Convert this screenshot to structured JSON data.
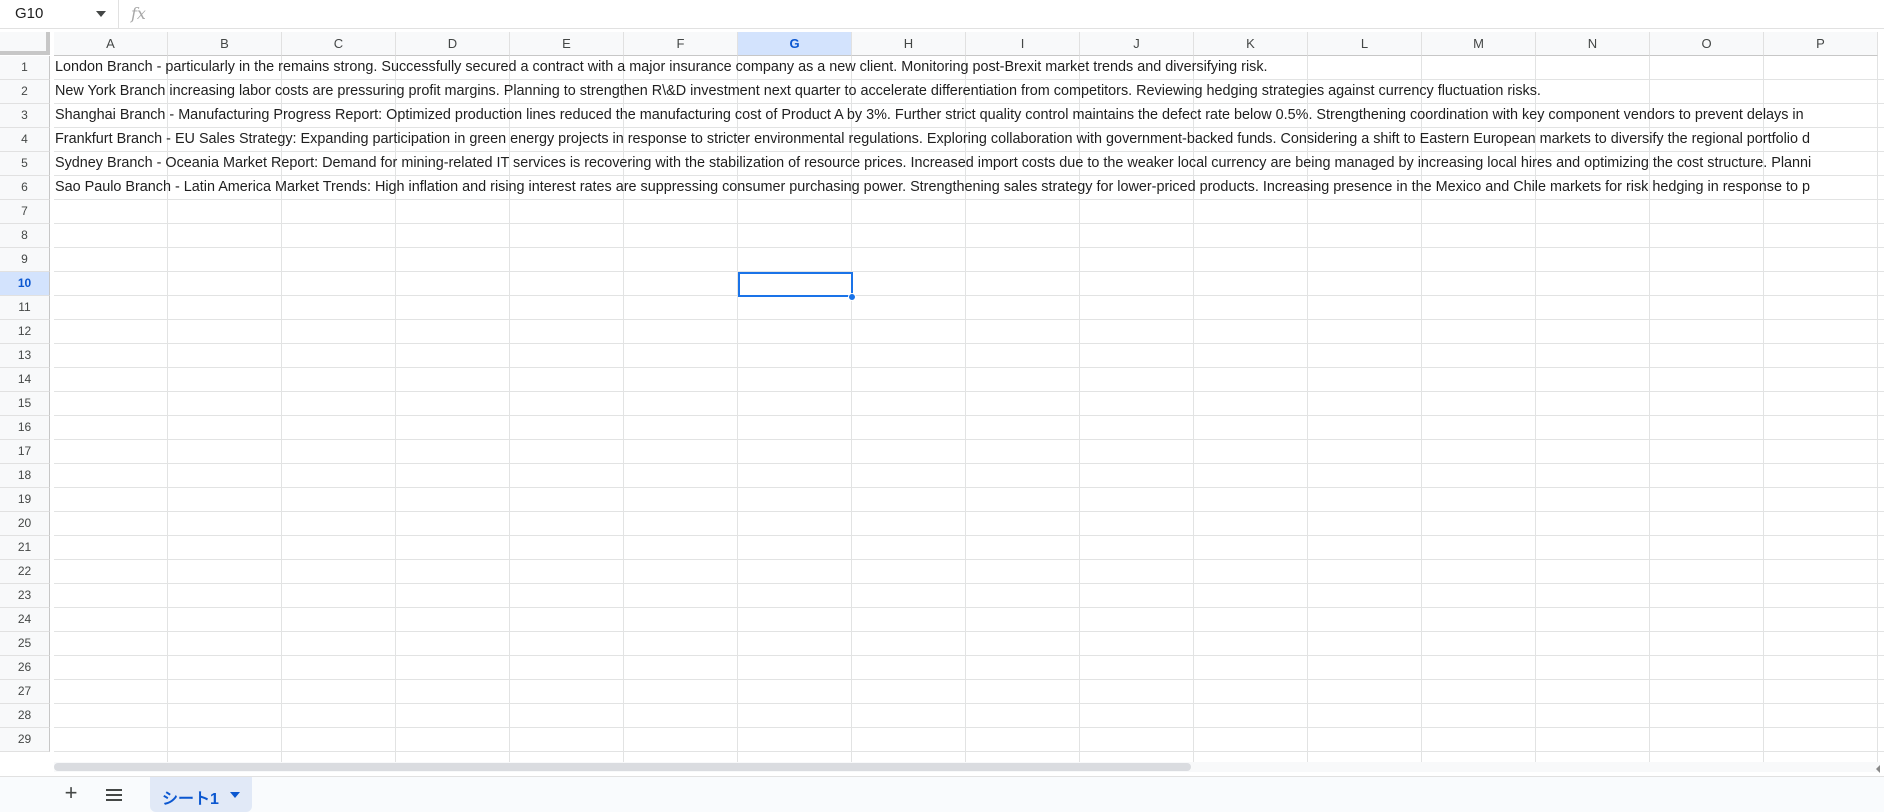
{
  "formula_bar": {
    "name_box": "G10",
    "fx_label": "fx",
    "formula": ""
  },
  "grid": {
    "columns": [
      "A",
      "B",
      "C",
      "D",
      "E",
      "F",
      "G",
      "H",
      "I",
      "J",
      "K",
      "L",
      "M",
      "N",
      "O",
      "P"
    ],
    "rows": [
      "1",
      "2",
      "3",
      "4",
      "5",
      "6",
      "7",
      "8",
      "9",
      "10",
      "11",
      "12",
      "13",
      "14",
      "15",
      "16",
      "17",
      "18",
      "19",
      "20",
      "21",
      "22",
      "23",
      "24",
      "25",
      "26",
      "27",
      "28",
      "29"
    ],
    "selected_column": "G",
    "selected_row": "10",
    "cells": [
      {
        "row": 1,
        "text": "London Branch - particularly in the remains strong. Successfully secured a contract with a major insurance company as a new client. Monitoring post-Brexit market trends and diversifying risk."
      },
      {
        "row": 2,
        "text": "New York Branch increasing labor costs are pressuring profit margins. Planning to strengthen R\\&D investment next quarter to accelerate differentiation from competitors. Reviewing hedging strategies against currency fluctuation risks."
      },
      {
        "row": 3,
        "text": "Shanghai Branch - Manufacturing Progress Report: Optimized production lines reduced the manufacturing cost of Product A by 3%. Further strict quality control maintains the defect rate below 0.5%. Strengthening coordination with key component vendors to prevent delays in"
      },
      {
        "row": 4,
        "text": "Frankfurt Branch - EU Sales Strategy: Expanding participation in green energy projects in response to stricter environmental regulations. Exploring collaboration with government-backed funds. Considering a shift to Eastern European markets to diversify the regional portfolio d"
      },
      {
        "row": 5,
        "text": "Sydney Branch - Oceania Market Report: Demand for mining-related IT services is recovering with the stabilization of resource prices. Increased import costs due to the weaker local currency are being managed by increasing local hires and optimizing the cost structure. Planni"
      },
      {
        "row": 6,
        "text": "Sao Paulo Branch - Latin America Market Trends: High inflation and rising interest rates are suppressing consumer purchasing power. Strengthening sales strategy for lower-priced products. Increasing presence in the Mexico and Chile markets for risk hedging in response to p"
      }
    ]
  },
  "sheet_bar": {
    "add_label": "+",
    "active_sheet": "シート1"
  },
  "colors": {
    "accent": "#1a73e8",
    "header_selected_bg": "#d3e3fd",
    "header_selected_text": "#0b57d0"
  }
}
